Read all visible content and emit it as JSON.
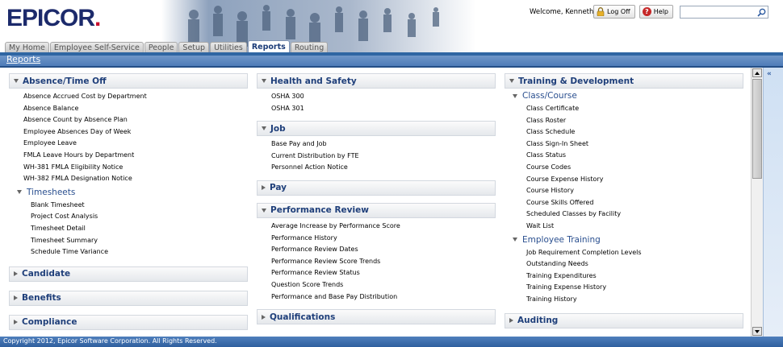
{
  "header": {
    "logo_text": "EPICOR",
    "welcome": "Welcome, Kenneth",
    "logoff_label": "Log Off",
    "help_label": "Help",
    "search_value": ""
  },
  "tabs": [
    {
      "label": "My Home"
    },
    {
      "label": "Employee Self-Service"
    },
    {
      "label": "People"
    },
    {
      "label": "Setup"
    },
    {
      "label": "Utilities"
    },
    {
      "label": "Reports"
    },
    {
      "label": "Routing"
    }
  ],
  "page_title": "Reports",
  "columns": {
    "col1": {
      "absence": {
        "title": "Absence/Time Off",
        "items": [
          "Absence Accrued Cost by Department",
          "Absence Balance",
          "Absence Count by Absence Plan",
          "Employee Absences Day of Week",
          "Employee Leave",
          "FMLA Leave Hours by Department",
          "WH-381 FMLA Eligibility Notice",
          "WH-382 FMLA Designation Notice"
        ],
        "timesheets": {
          "title": "Timesheets",
          "items": [
            "Blank Timesheet",
            "Project Cost Analysis",
            "Timesheet Detail",
            "Timesheet Summary",
            "Schedule Time Variance"
          ]
        }
      },
      "candidate": {
        "title": "Candidate"
      },
      "benefits": {
        "title": "Benefits"
      },
      "compliance": {
        "title": "Compliance"
      }
    },
    "col2": {
      "health": {
        "title": "Health and Safety",
        "items": [
          "OSHA 300",
          "OSHA 301"
        ]
      },
      "job": {
        "title": "Job",
        "items": [
          "Base Pay and Job",
          "Current Distribution by FTE",
          "Personnel Action Notice"
        ]
      },
      "pay": {
        "title": "Pay"
      },
      "performance": {
        "title": "Performance Review",
        "items": [
          "Average Increase by Performance Score",
          "Performance History",
          "Performance Review Dates",
          "Performance Review Score Trends",
          "Performance Review Status",
          "Question Score Trends",
          "Performance and Base Pay Distribution"
        ]
      },
      "qualifications": {
        "title": "Qualifications"
      }
    },
    "col3": {
      "training": {
        "title": "Training & Development",
        "classcourse": {
          "title": "Class/Course",
          "items": [
            "Class Certificate",
            "Class Roster",
            "Class Schedule",
            "Class Sign-In Sheet",
            "Class Status",
            "Course Codes",
            "Course Expense History",
            "Course History",
            "Course Skills Offered",
            "Scheduled Classes by Facility",
            "Wait List"
          ]
        },
        "employee_training": {
          "title": "Employee Training",
          "items": [
            "Job Requirement Completion Levels",
            "Outstanding Needs",
            "Training Expenditures",
            "Training Expense History",
            "Training History"
          ]
        }
      },
      "auditing": {
        "title": "Auditing"
      }
    }
  },
  "footer": {
    "copyright": "Copyright 2012, Epicor Software Corporation. All Rights Reserved."
  },
  "side_panel": {
    "collapse_glyph": "«"
  },
  "colors": {
    "brand_navy": "#1c2a6b",
    "brand_red": "#c8102e",
    "bar_blue": "#2f66a3",
    "section_title": "#1f3f7a"
  }
}
